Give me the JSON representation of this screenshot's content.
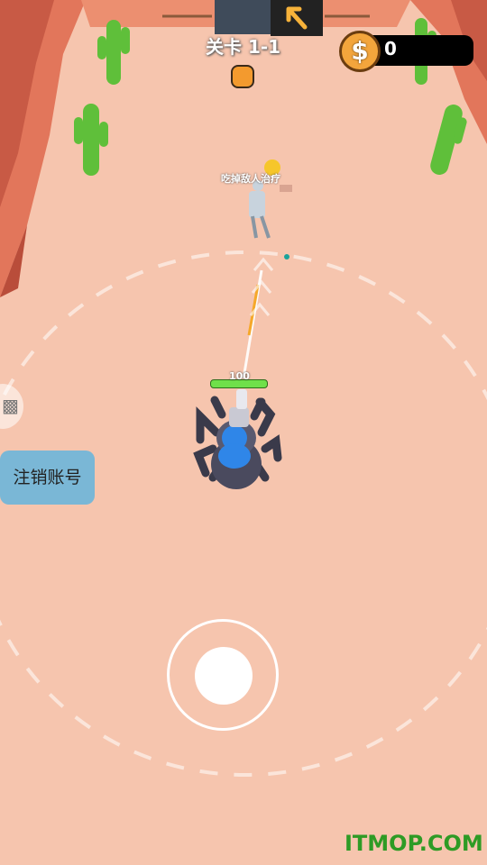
{
  "hud": {
    "level_label": "关卡 1-1",
    "coin_symbol": "$",
    "coin_count": "0",
    "coin_color": "#f3a53c",
    "level_dot_color": "#f39a2e"
  },
  "enemy": {
    "hint_text": "吃掉敌人治疗"
  },
  "player": {
    "hp_text": "100",
    "hp_fraction": 1.0,
    "hp_color": "#6fe04a",
    "body_color": "#2f86e8"
  },
  "side_panel": {
    "camera_icon": "camera-icon",
    "logout_label": "注销账号",
    "logout_color": "#7ab7d6"
  },
  "joystick": {
    "ring_icon": "joystick-ring",
    "knob_icon": "joystick-knob"
  },
  "watermark": "ITMOP.COM"
}
